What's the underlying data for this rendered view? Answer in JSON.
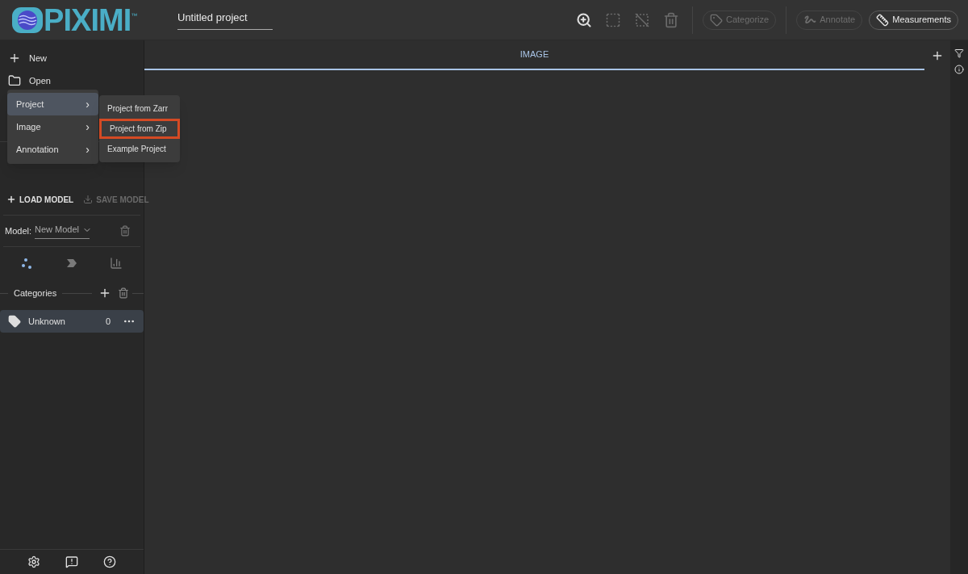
{
  "logo": {
    "text": "PIXIMI",
    "trademark": "™"
  },
  "project_name": "Untitled project",
  "toolbar": {
    "icons": [
      {
        "kind": "zoom",
        "disabled": false
      },
      {
        "kind": "select-all",
        "disabled": true
      },
      {
        "kind": "deselect",
        "disabled": true
      },
      {
        "kind": "delete",
        "disabled": true
      }
    ],
    "modes": [
      {
        "kind": "categorize",
        "label": "Categorize",
        "disabled": true
      },
      {
        "kind": "annotate",
        "label": "Annotate",
        "disabled": true
      },
      {
        "kind": "measurements",
        "label": "Measurements",
        "disabled": false
      }
    ]
  },
  "file_menu": [
    {
      "kind": "new",
      "label": "New"
    },
    {
      "kind": "open",
      "label": "Open"
    }
  ],
  "open_menu": [
    {
      "label": "Project",
      "selected": true
    },
    {
      "label": "Image",
      "selected": false
    },
    {
      "label": "Annotation",
      "selected": false
    }
  ],
  "open_menu_arrow": "›",
  "submenu": [
    {
      "label": "Project from Zarr",
      "outlined": false
    },
    {
      "label": "Project from Zip",
      "outlined": true
    },
    {
      "label": "Example Project",
      "outlined": false
    }
  ],
  "model_buttons": [
    {
      "label": "LOAD MODEL",
      "disabled": false
    },
    {
      "label": "SAVE MODEL",
      "disabled": true
    }
  ],
  "model": {
    "label": "Model:",
    "value": "New Model"
  },
  "model_tabs": [
    {
      "kind": "cluster",
      "selected": true
    },
    {
      "kind": "chevron",
      "selected": false
    },
    {
      "kind": "chart",
      "selected": false
    }
  ],
  "categories": {
    "title": "Categories",
    "items": [
      {
        "name": "Unknown",
        "count": "0",
        "selected": true
      }
    ]
  },
  "tabs": [
    {
      "label": "IMAGE",
      "selected": true
    }
  ]
}
